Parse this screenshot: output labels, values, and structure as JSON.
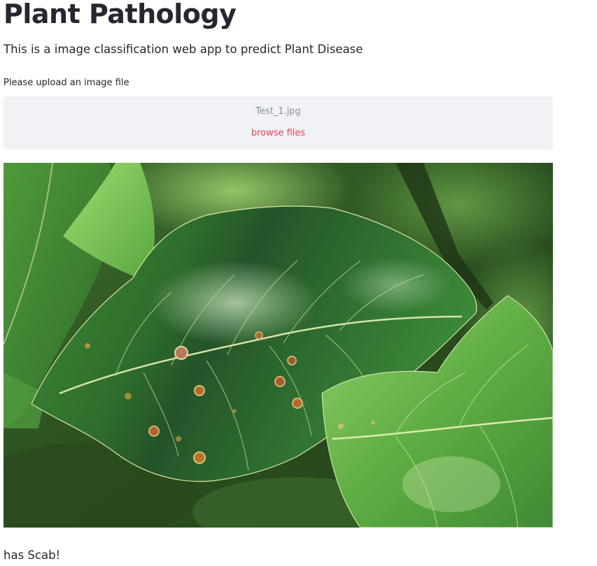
{
  "page": {
    "title": "Plant Pathology",
    "subtitle": "This is a image classification web app to predict Plant Disease"
  },
  "uploader": {
    "label": "Please upload an image file",
    "filename": "Test_1.jpg",
    "browse_label": "browse files"
  },
  "image": {
    "subject": "apple leaf with scab lesions"
  },
  "result": {
    "text": "has Scab!"
  },
  "colors": {
    "text": "#262730",
    "dropzone_bg": "#f0f2f6",
    "browse_link": "#e2435a",
    "filename_text": "#8a90a0"
  }
}
